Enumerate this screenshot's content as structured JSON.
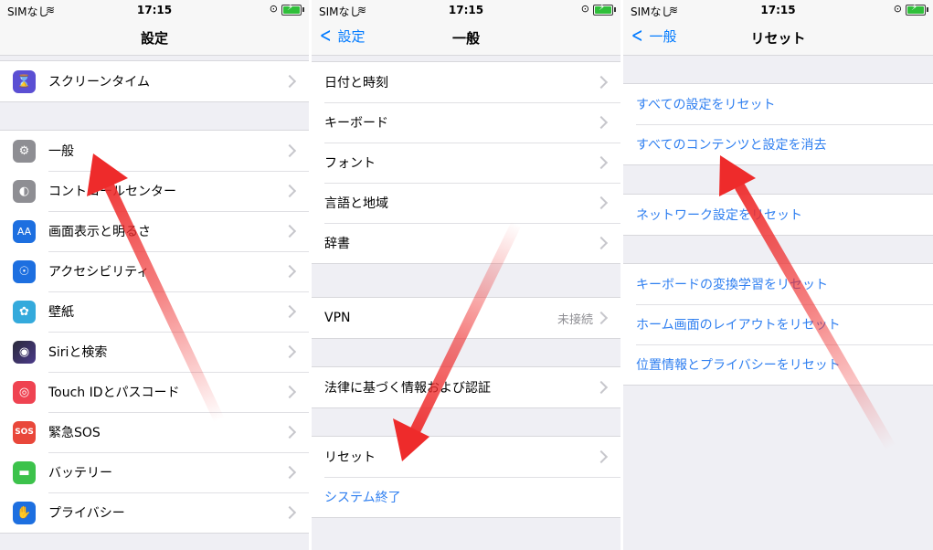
{
  "status": {
    "carrier": "SIMなし",
    "time": "17:15"
  },
  "panel1": {
    "title": "設定",
    "items": [
      {
        "label": "スクリーンタイム",
        "icon": "hourglass-icon",
        "color": "#5b4fd3",
        "glyph": "⌛"
      },
      {
        "label": "一般",
        "icon": "gear-icon",
        "color": "#8e8e93",
        "glyph": "⚙"
      },
      {
        "label": "コントロールセンター",
        "icon": "toggle-icon",
        "color": "#8e8e93",
        "glyph": "◐"
      },
      {
        "label": "画面表示と明るさ",
        "icon": "text-size-icon",
        "color": "#1d6fe0",
        "glyph": "AA"
      },
      {
        "label": "アクセシビリティ",
        "icon": "accessibility-icon",
        "color": "#1d6fe0",
        "glyph": "☉"
      },
      {
        "label": "壁紙",
        "icon": "flower-icon",
        "color": "#34aadc",
        "glyph": "✿"
      },
      {
        "label": "Siriと検索",
        "icon": "siri-icon",
        "color": "#2a2a3a",
        "glyph": "◉"
      },
      {
        "label": "Touch IDとパスコード",
        "icon": "fingerprint-icon",
        "color": "#ef4351",
        "glyph": "◎"
      },
      {
        "label": "緊急SOS",
        "icon": "sos-icon",
        "color": "#e9473a",
        "glyph": "SOS"
      },
      {
        "label": "バッテリー",
        "icon": "battery-icon",
        "color": "#3cc24b",
        "glyph": "▬"
      },
      {
        "label": "プライバシー",
        "icon": "hand-icon",
        "color": "#1d6fe0",
        "glyph": "✋"
      }
    ]
  },
  "panel2": {
    "back": "設定",
    "title": "一般",
    "group1": [
      "日付と時刻",
      "キーボード",
      "フォント",
      "言語と地域",
      "辞書"
    ],
    "vpn": {
      "label": "VPN",
      "value": "未接続"
    },
    "legal": "法律に基づく情報および認証",
    "reset": "リセット",
    "shutdown": "システム終了"
  },
  "panel3": {
    "back": "一般",
    "title": "リセット",
    "group1": [
      "すべての設定をリセット",
      "すべてのコンテンツと設定を消去"
    ],
    "group2": [
      "ネットワーク設定をリセット"
    ],
    "group3": [
      "キーボードの変換学習をリセット",
      "ホーム画面のレイアウトをリセット",
      "位置情報とプライバシーをリセット"
    ]
  },
  "colors": {
    "accent": "#007aff",
    "arrow": "#ee2b2b"
  }
}
